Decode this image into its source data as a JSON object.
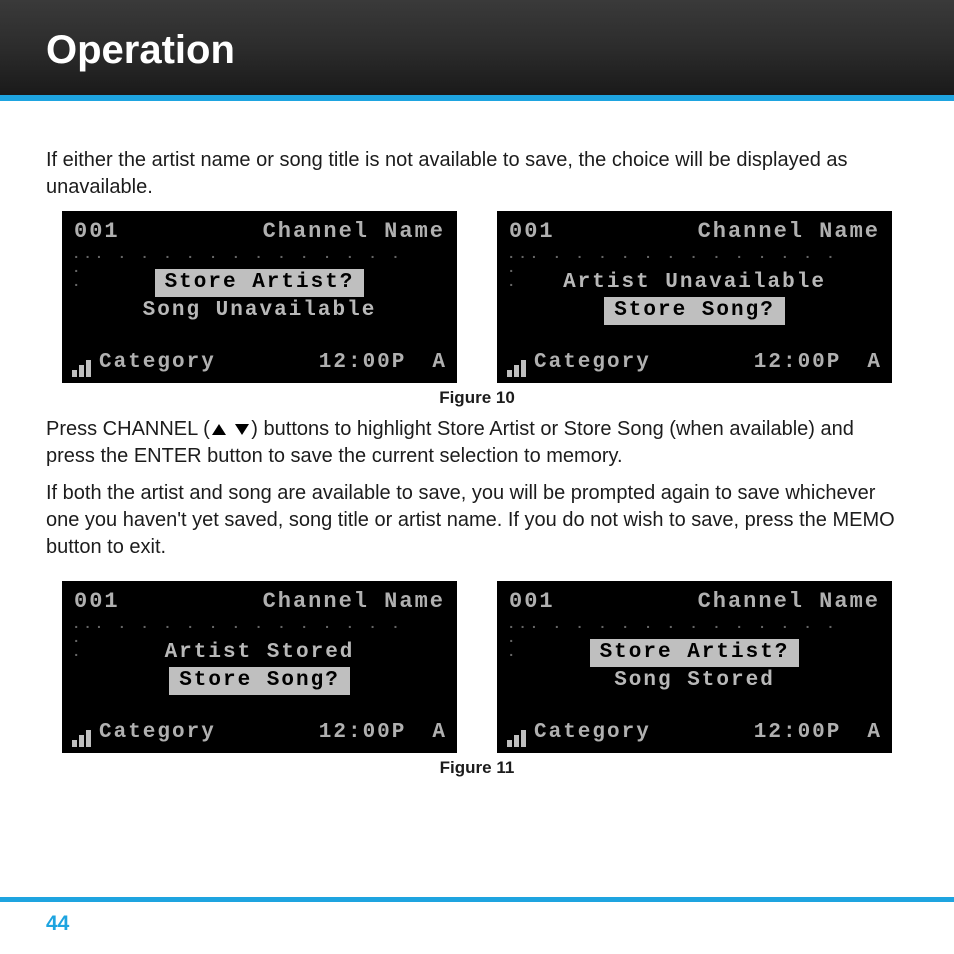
{
  "header": {
    "title": "Operation"
  },
  "paragraphs": {
    "p1": "If either the artist name or song title is not available to save, the choice will be displayed as unavailable.",
    "p2a": "Press CHANNEL (",
    "p2b": ") buttons to highlight Store Artist or Store Song (when available) and press the ENTER button to save the current selection to memory.",
    "p3": "If both the artist and song are available to save, you will be prompted again to save whichever one you haven't yet saved, song title or artist name. If you do not wish to save, press the MEMO button to exit."
  },
  "figures": {
    "fig10_label": "Figure 10",
    "fig11_label": "Figure 11"
  },
  "lcd_common": {
    "channel_num": "001",
    "channel_name": "Channel Name",
    "category": "Category",
    "time": "12:00P",
    "ant": "A"
  },
  "lcds": {
    "a": {
      "line1": "Store Artist?",
      "line2": "Song Unavailable",
      "hl": 1
    },
    "b": {
      "line1": "Artist Unavailable",
      "line2": "Store Song?",
      "hl": 2
    },
    "c": {
      "line1": "Artist Stored",
      "line2": "Store Song?",
      "hl": 2
    },
    "d": {
      "line1": "Store Artist?",
      "line2": "Song Stored",
      "hl": 1
    }
  },
  "page_number": "44"
}
